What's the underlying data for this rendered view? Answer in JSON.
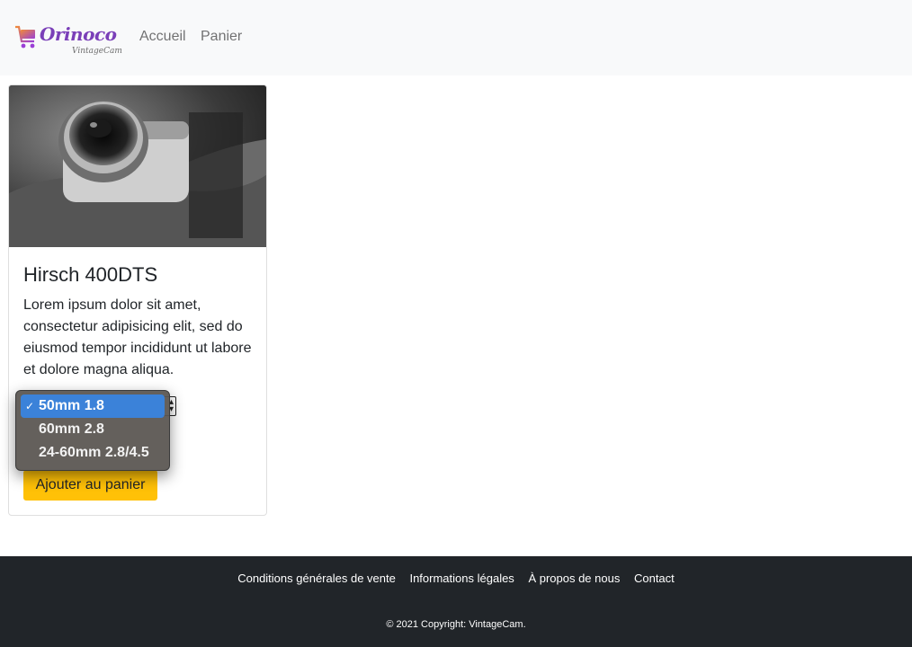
{
  "navbar": {
    "logo_brand": "Orinoco",
    "logo_tagline": "VintageCam",
    "links": [
      "Accueil",
      "Panier"
    ]
  },
  "product": {
    "image_alt": "Hirsch 400DTS camera",
    "title": "Hirsch 400DTS",
    "description": "Lorem ipsum dolor sit amet, consectetur adipisicing elit, sed do eiusmod tempor incididunt ut labore et dolore magna aliqua.",
    "lens_select": {
      "selected": "50mm 1.8",
      "options": [
        "50mm 1.8",
        "60mm 2.8",
        "24-60mm 2.8/4.5"
      ]
    },
    "add_button": "Ajouter au panier"
  },
  "footer": {
    "links": [
      "Conditions générales de vente",
      "Informations légales",
      "À propos de nous",
      "Contact"
    ],
    "copyright": "© 2021 Copyright: VintageCam."
  },
  "colors": {
    "navbar_bg": "#f8f9fa",
    "button_bg": "#ffc107",
    "footer_bg": "#212529",
    "dropdown_selected": "#3b82d9",
    "logo": "#7a3fb8"
  }
}
